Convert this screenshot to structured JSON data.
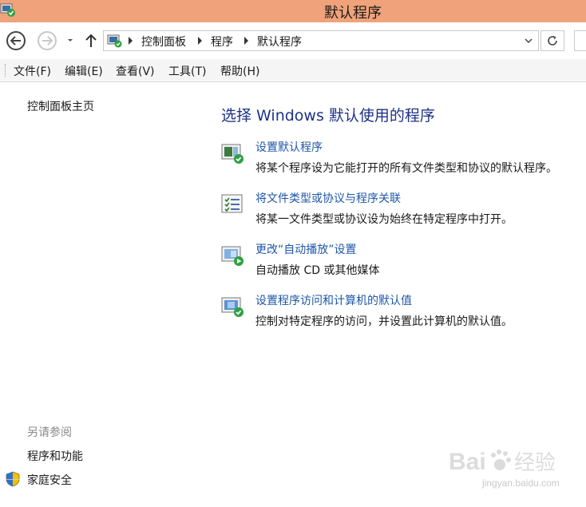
{
  "window": {
    "title": "默认程序"
  },
  "address_bar": {
    "breadcrumbs": [
      "控制面板",
      "程序",
      "默认程序"
    ]
  },
  "menu": {
    "items": [
      "文件(F)",
      "编辑(E)",
      "查看(V)",
      "工具(T)",
      "帮助(H)"
    ]
  },
  "left_pane": {
    "home_link": "控制面板主页",
    "see_also_label": "另请参阅",
    "see_also_links": [
      "程序和功能",
      "家庭安全"
    ]
  },
  "main": {
    "title": "选择 Windows 默认使用的程序",
    "tasks": [
      {
        "link": "设置默认程序",
        "desc": "将某个程序设为它能打开的所有文件类型和协议的默认程序。",
        "icon": "default-programs-icon"
      },
      {
        "link": "将文件类型或协议与程序关联",
        "desc": "将某一文件类型或协议设为始终在特定程序中打开。",
        "icon": "file-association-icon"
      },
      {
        "link": "更改“自动播放”设置",
        "desc": "自动播放 CD 或其他媒体",
        "icon": "autoplay-icon"
      },
      {
        "link": "设置程序访问和计算机的默认值",
        "desc": "控制对特定程序的访问，并设置此计算机的默认值。",
        "icon": "program-access-icon"
      }
    ]
  },
  "watermark": {
    "text": "jingyan.baidu.com"
  },
  "colors": {
    "titlebar": "#f0a27a",
    "link": "#1e57a8",
    "heading": "#1e3287"
  }
}
